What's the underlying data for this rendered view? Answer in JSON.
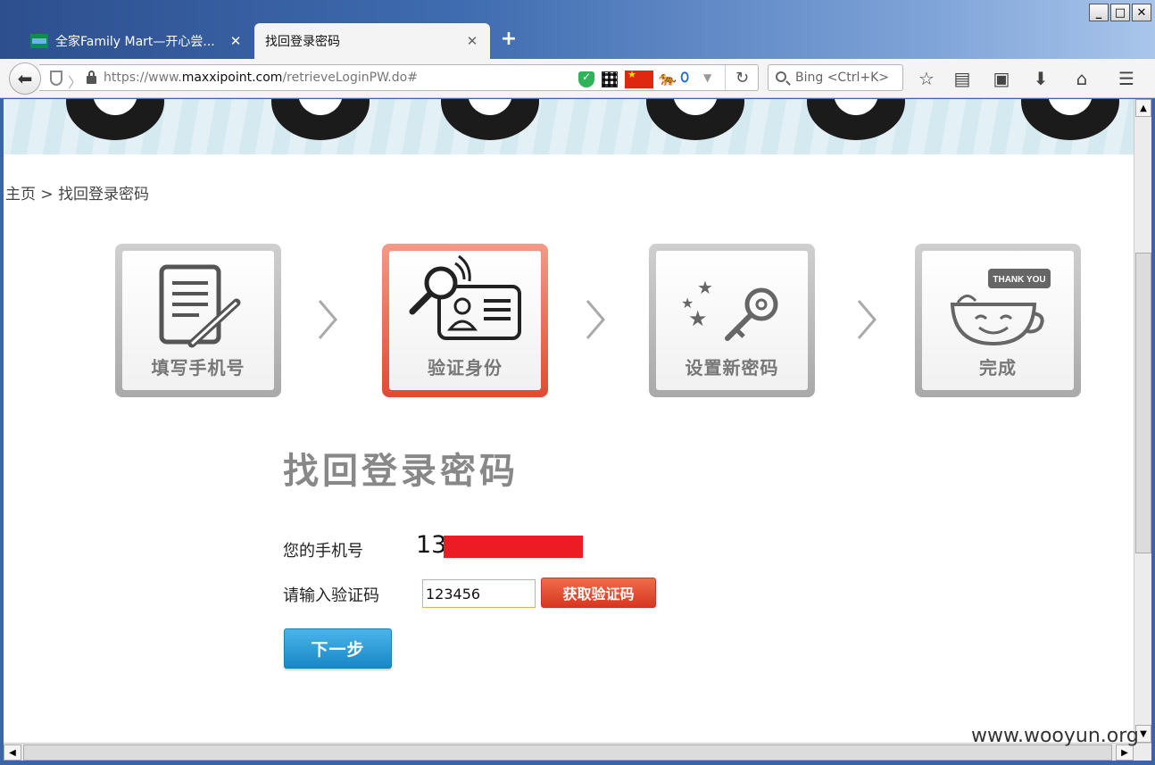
{
  "window": {
    "controls": [
      "_",
      "□",
      "✕"
    ]
  },
  "tabs": [
    {
      "label": "全家Family Mart—开心尝...",
      "close": "✕",
      "active": false
    },
    {
      "label": "找回登录密码",
      "close": "✕",
      "active": true
    }
  ],
  "new_tab": "+",
  "url": {
    "prefix": "https://www.",
    "host": "maxxipoint.com",
    "path": "/retrieveLoginPW.do#"
  },
  "search": {
    "placeholder": "Bing <Ctrl+K>"
  },
  "toolbar_icons": [
    "star-icon",
    "reading-list-icon",
    "screenshot-icon",
    "download-icon",
    "home-icon",
    "menu-icon"
  ],
  "breadcrumb": {
    "home": "主页",
    "sep": ">",
    "current": "找回登录密码"
  },
  "steps": [
    {
      "label": "填写手机号",
      "active": false
    },
    {
      "label": "验证身份",
      "active": true
    },
    {
      "label": "设置新密码",
      "active": false
    },
    {
      "label": "完成",
      "active": false,
      "badge": "THANK YOU"
    }
  ],
  "form": {
    "title": "找回登录密码",
    "phone_label": "您的手机号",
    "phone_value": "13",
    "code_label": "请输入验证码",
    "code_value": "123456",
    "get_code": "获取验证码",
    "next": "下一步"
  },
  "watermark": "www.wooyun.org",
  "colors": {
    "accent_red": "#e04b33",
    "accent_blue": "#1887c6",
    "redact": "#ed1c24"
  }
}
